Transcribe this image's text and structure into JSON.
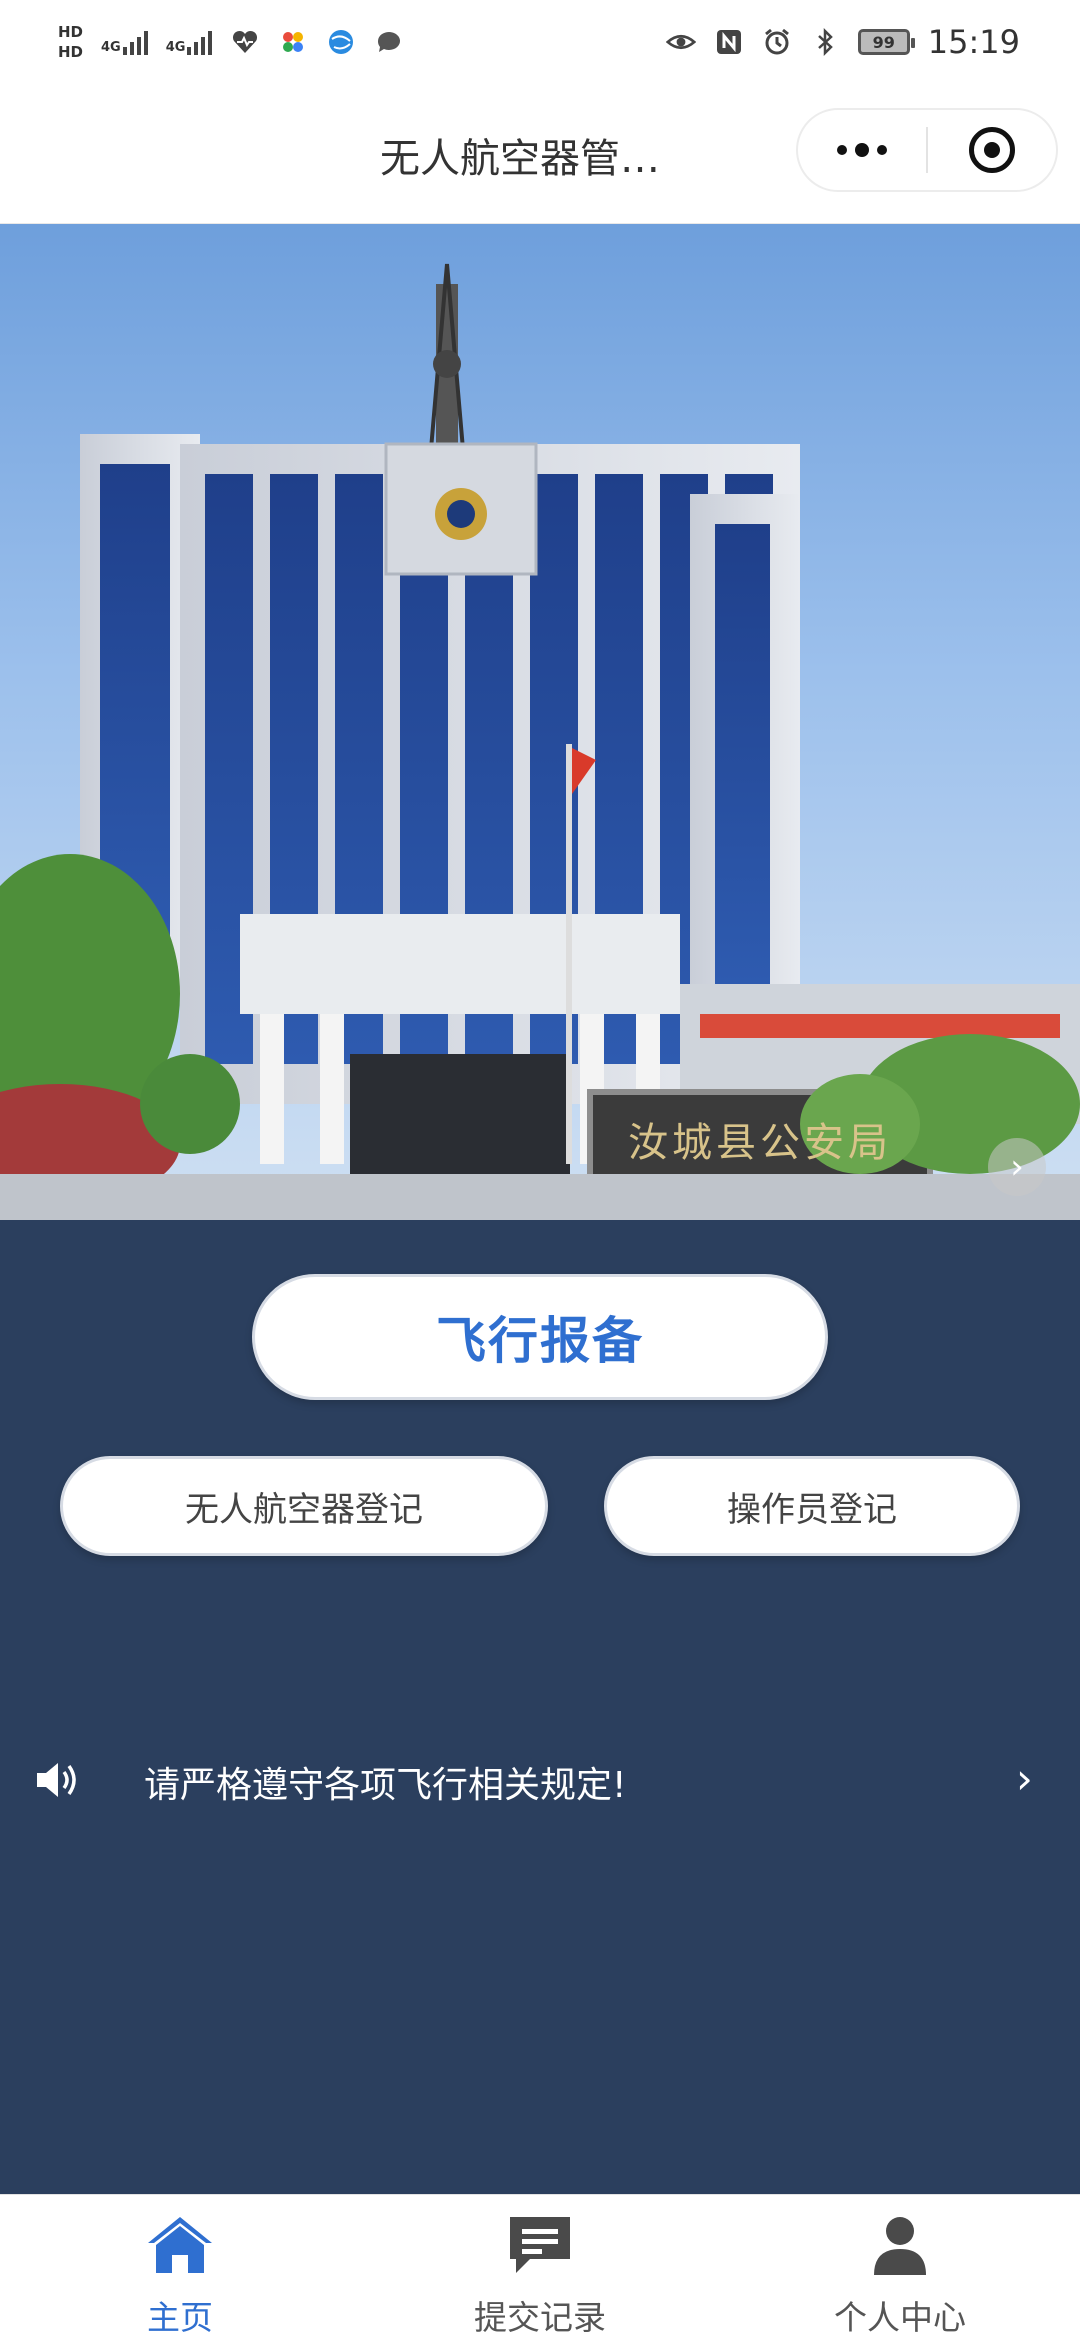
{
  "status_bar": {
    "hd1": "HD",
    "hd2": "HD",
    "net1": "4G",
    "net2": "4G",
    "battery": "99",
    "time": "15:19"
  },
  "nav": {
    "title": "无人航空器管…"
  },
  "banner": {
    "sign_text": "汝城县公安局"
  },
  "actions": {
    "flight_report": "飞行报备",
    "uav_register": "无人航空器登记",
    "operator_register": "操作员登记"
  },
  "notice": {
    "text": "请严格遵守各项飞行相关规定!"
  },
  "tabbar": {
    "home": "主页",
    "records": "提交记录",
    "profile": "个人中心"
  },
  "colors": {
    "background": "#2b3f5e",
    "accent": "#2f6fd0",
    "inactive_tab": "#555555"
  },
  "icons": [
    "speaker-icon",
    "chevron-right-icon",
    "home-icon",
    "message-icon",
    "person-icon",
    "more-icon",
    "close-target-icon"
  ]
}
